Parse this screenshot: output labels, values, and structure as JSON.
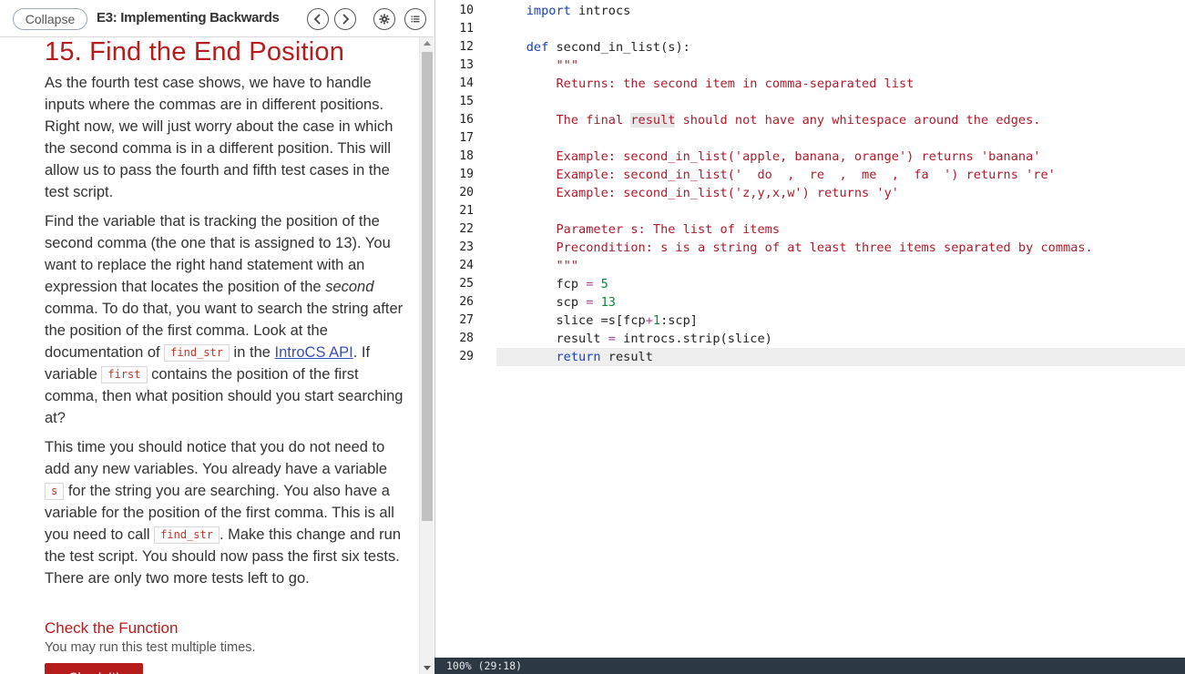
{
  "header": {
    "collapse_label": "Collapse",
    "guide_title": "E3: Implementing Backwards",
    "prev_icon": "chevron-left-icon",
    "next_icon": "chevron-right-icon",
    "settings_icon": "gear-icon",
    "toc_icon": "list-icon"
  },
  "guide": {
    "section_title": "15. Find the End Position",
    "p1": "As the fourth test case shows, we have to handle inputs where the commas are in different positions. Right now, we will just worry about the case in which the second comma is in a different position. This will allow us to pass the fourth and fifth test cases in the test script.",
    "p2_a": "Find the variable that is tracking the position of the second comma (the one that is assigned to 13). You want to replace the right hand statement with an expression that locates the position of the ",
    "p2_em": "second",
    "p2_b": " comma. To do that, you want to search the string after the position of the first comma. Look at the documentation of ",
    "p2_code1": "find_str",
    "p2_c": " in the ",
    "p2_link": "IntroCS API",
    "p2_d": ". If variable ",
    "p2_code2": "first",
    "p2_e": " contains the position of the first comma, then what position should you start searching at?",
    "p3_a": "This time you should notice that you do not need to add any new variables. You already have a variable ",
    "p3_code1": "s",
    "p3_b": " for the string you are searching. You also have a variable for the position of the first comma. This is all you need to call ",
    "p3_code2": "find_str",
    "p3_c": ". Make this change and run the test script. You should now pass the first six tests. There are only two more tests left to go.",
    "check_title": "Check the Function",
    "check_sub": "You may run this test multiple times.",
    "check_button": "Check It!"
  },
  "editor": {
    "lines": [
      {
        "n": "10",
        "text": "import introcs"
      },
      {
        "n": "11",
        "text": ""
      },
      {
        "n": "12",
        "text": "def second_in_list(s):"
      },
      {
        "n": "13",
        "text": "    \"\"\""
      },
      {
        "n": "14",
        "text": "    Returns: the second item in comma-separated list"
      },
      {
        "n": "15",
        "text": ""
      },
      {
        "n": "16",
        "text": "    The final result should not have any whitespace around the edges."
      },
      {
        "n": "17",
        "text": ""
      },
      {
        "n": "18",
        "text": "    Example: second_in_list('apple, banana, orange') returns 'banana'"
      },
      {
        "n": "19",
        "text": "    Example: second_in_list('  do  ,  re  ,  me  ,  fa  ') returns 're'"
      },
      {
        "n": "20",
        "text": "    Example: second_in_list('z,y,x,w') returns 'y'"
      },
      {
        "n": "21",
        "text": ""
      },
      {
        "n": "22",
        "text": "    Parameter s: The list of items"
      },
      {
        "n": "23",
        "text": "    Precondition: s is a string of at least three items separated by commas."
      },
      {
        "n": "24",
        "text": "    \"\"\""
      },
      {
        "n": "25",
        "text": "    fcp = 5"
      },
      {
        "n": "26",
        "text": "    scp = 13"
      },
      {
        "n": "27",
        "text": "    slice =s[fcp+1:scp]"
      },
      {
        "n": "28",
        "text": "    result = introcs.strip(slice)"
      },
      {
        "n": "29",
        "text": "    return result"
      }
    ],
    "active_line": "29"
  },
  "status": {
    "text": "100% (29:18)"
  },
  "colors": {
    "accent": "#b71c1c",
    "keyword": "#1a3fbf",
    "string": "#b01a2a",
    "number": "#0b8a35",
    "status_bg": "#2d3845"
  }
}
